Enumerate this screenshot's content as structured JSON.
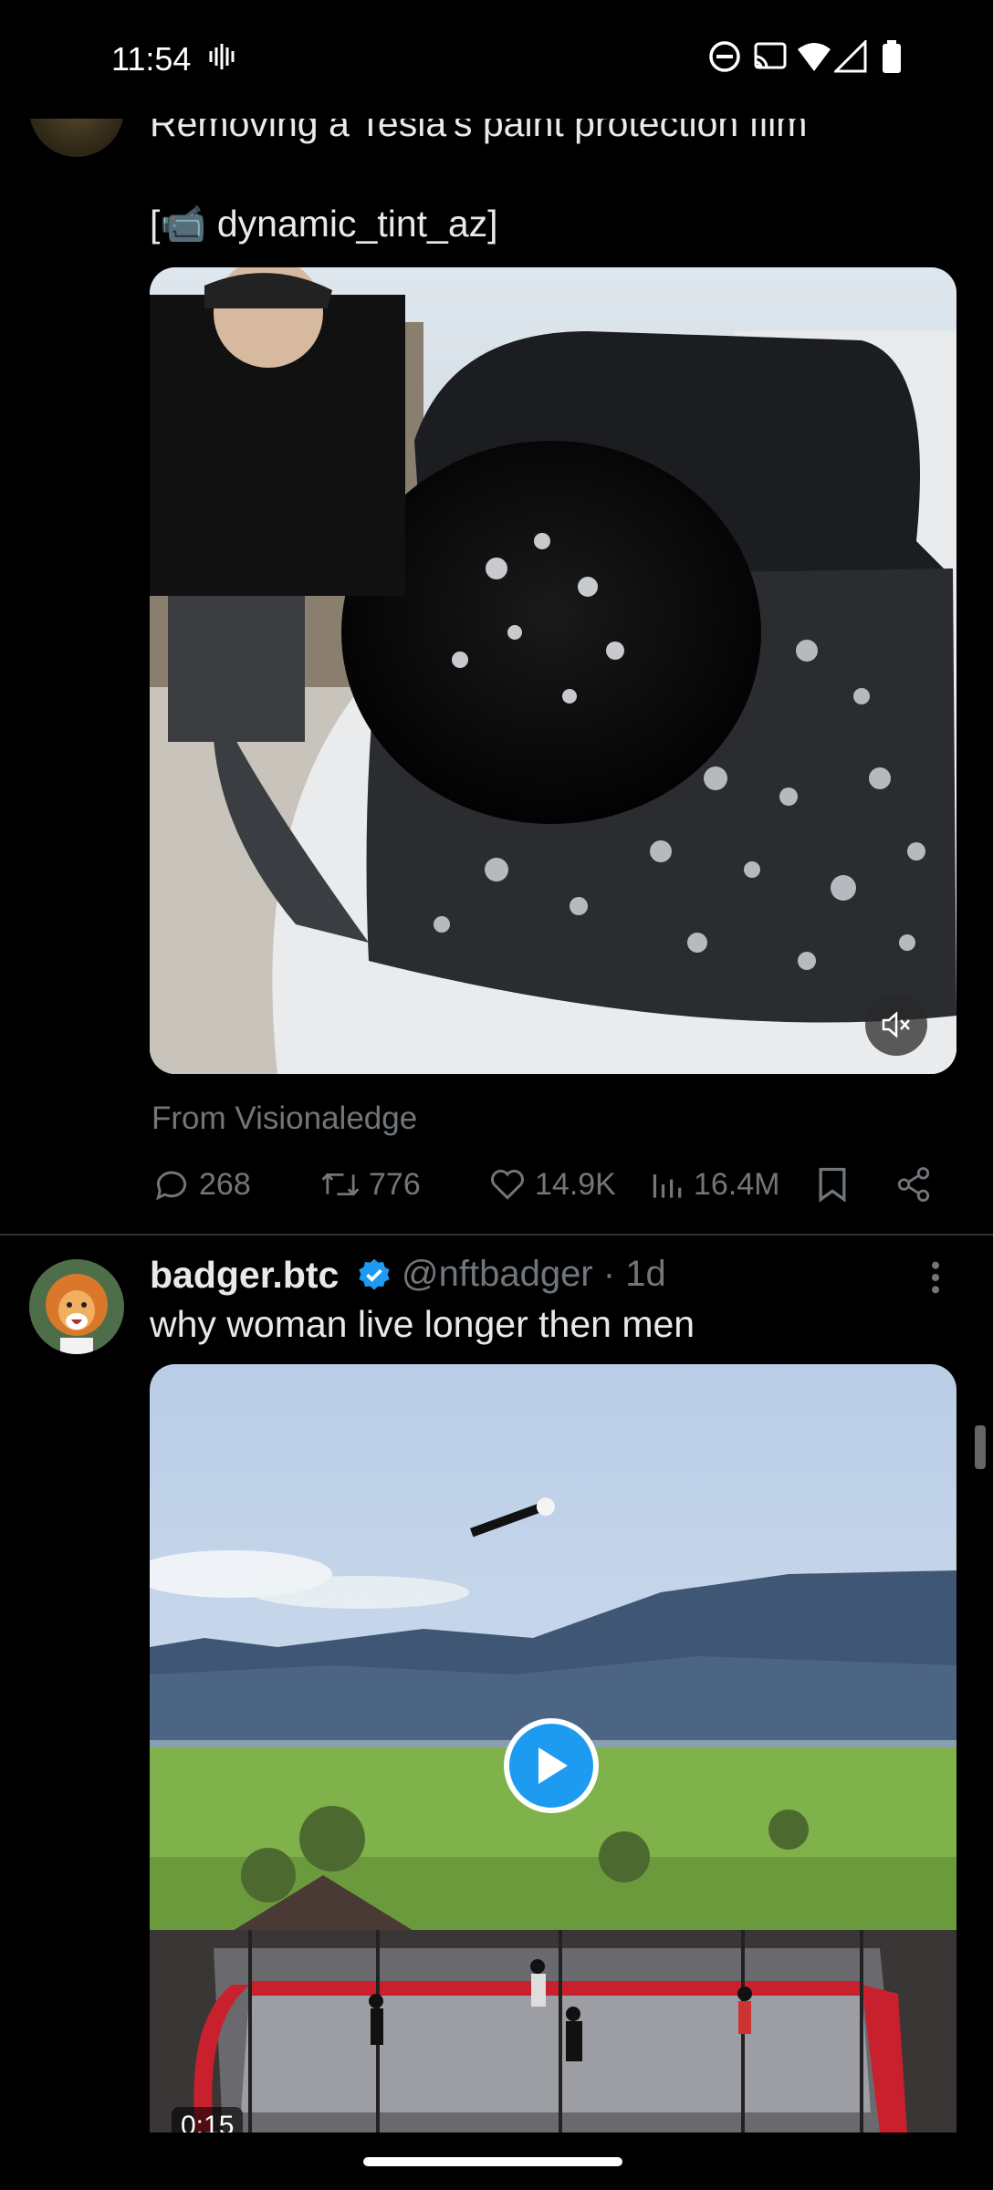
{
  "status_bar": {
    "time": "11:54",
    "icons": [
      "vibrate-icon",
      "do-not-disturb-icon",
      "cast-icon",
      "wifi-icon",
      "cellular-icon",
      "battery-icon"
    ]
  },
  "tweet1": {
    "text": "Removing a Tesla's paint protection film",
    "credit_prefix": "[",
    "credit_emoji": "📹",
    "credit_name": " dynamic_tint_az]",
    "source": "From Visionaledge",
    "actions": {
      "replies": "268",
      "reposts": "776",
      "likes": "14.9K",
      "views": "16.4M"
    }
  },
  "tweet2": {
    "display_name": "badger.btc",
    "handle": "@nftbadger",
    "dot": "·",
    "age": "1d",
    "text": "why woman live longer then men",
    "duration": "0:15"
  },
  "colors": {
    "background": "#000000",
    "text": "#e7e9ea",
    "muted": "#71767b",
    "accent": "#1d9bf0",
    "divider": "#2f3336"
  }
}
